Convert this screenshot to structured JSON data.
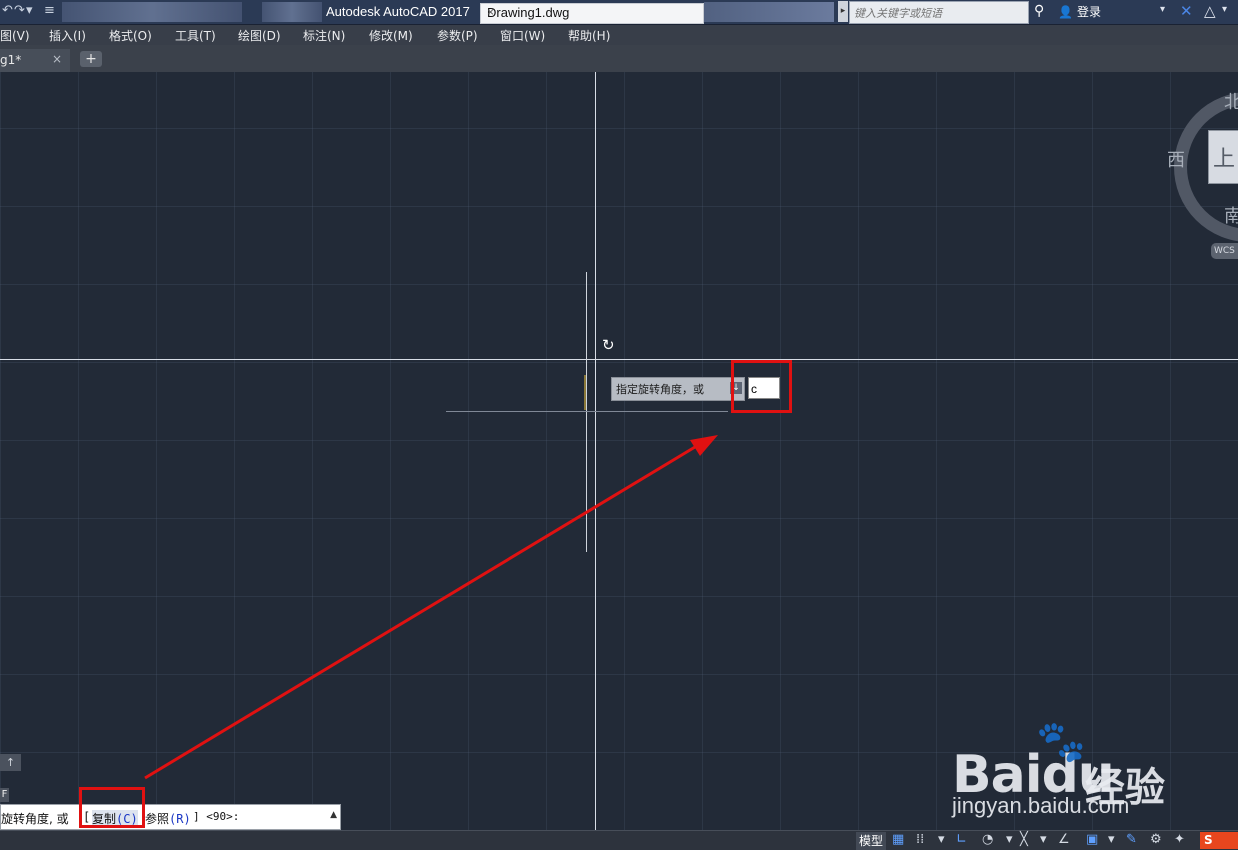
{
  "titlebar": {
    "app_title": "Autodesk AutoCAD 2017",
    "doc_title": "Drawing1.dwg",
    "search_placeholder": "键入关键字或短语",
    "user_label": "登录",
    "qat_icons": [
      "undo-icon",
      "redo-icon",
      "dropdown-icon",
      "customize-icon"
    ]
  },
  "menu": {
    "items": [
      "图(V)",
      "插入(I)",
      "格式(O)",
      "工具(T)",
      "绘图(D)",
      "标注(N)",
      "修改(M)",
      "参数(P)",
      "窗口(W)",
      "帮助(H)"
    ]
  },
  "tabs": {
    "active_label": "g1*",
    "close_glyph": "×",
    "add_glyph": "+"
  },
  "canvas": {
    "tooltip_prompt": "指定旋转角度，或",
    "dynamic_input_value": "c"
  },
  "viewcube": {
    "north": "北",
    "west": "西",
    "south": "南",
    "face": "上",
    "wcs": "WCS"
  },
  "command": {
    "prefix": "旋转角度, 或",
    "bracket_open": "[",
    "opt_copy_text": "复制",
    "opt_copy_key": "(C)",
    "opt_ref_text": "参照",
    "opt_ref_key": "(R)",
    "suffix": "] <90>:",
    "history_up": "↑",
    "side_label": "F"
  },
  "statusbar": {
    "model_label": "模型"
  },
  "watermark": {
    "brand": "Bai",
    "brand_du": "du",
    "jingyan": "经验",
    "url": "jingyan.baidu.com"
  },
  "annotation_color": "#e01111"
}
